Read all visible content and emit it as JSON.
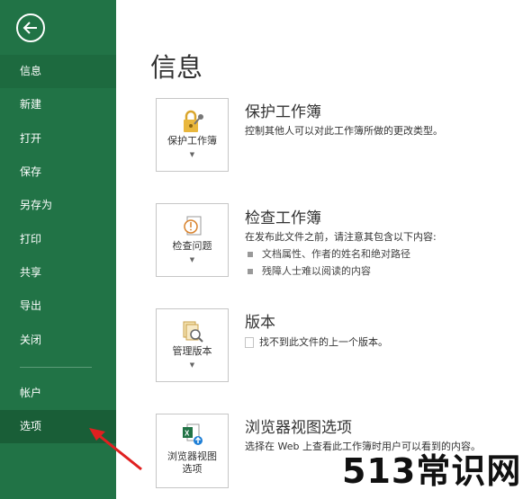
{
  "sidebar": {
    "items": [
      {
        "label": "信息",
        "state": "active"
      },
      {
        "label": "新建"
      },
      {
        "label": "打开"
      },
      {
        "label": "保存"
      },
      {
        "label": "另存为"
      },
      {
        "label": "打印"
      },
      {
        "label": "共享"
      },
      {
        "label": "导出"
      },
      {
        "label": "关闭"
      },
      {
        "label": "帐户"
      },
      {
        "label": "选项",
        "state": "hover"
      }
    ]
  },
  "main": {
    "title": "信息",
    "sections": [
      {
        "button": "保护工作簿",
        "title": "保护工作簿",
        "desc": "控制其他人可以对此工作簿所做的更改类型。"
      },
      {
        "button": "检查问题",
        "title": "检查工作簿",
        "desc": "在发布此文件之前，请注意其包含以下内容:",
        "bullets": [
          "文档属性、作者的姓名和绝对路径",
          "残障人士难以阅读的内容"
        ]
      },
      {
        "button": "管理版本",
        "title": "版本",
        "desc": "找不到此文件的上一个版本。"
      },
      {
        "button_line1": "浏览器视图",
        "button_line2": "选项",
        "title": "浏览器视图选项",
        "desc": "选择在 Web 上查看此工作簿时用户可以看到的内容。"
      }
    ]
  },
  "watermark": "513常识网",
  "colors": {
    "sidebar": "#217346",
    "arrow": "#e02020"
  }
}
